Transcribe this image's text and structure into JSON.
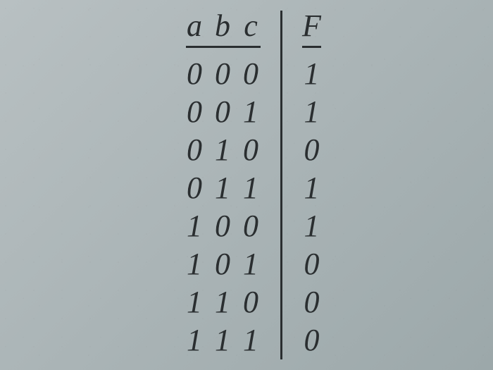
{
  "chart_data": {
    "type": "table",
    "title": "",
    "columns": [
      "a",
      "b",
      "c",
      "F"
    ],
    "rows": [
      {
        "a": "0",
        "b": "0",
        "c": "0",
        "F": "1"
      },
      {
        "a": "0",
        "b": "0",
        "c": "1",
        "F": "1"
      },
      {
        "a": "0",
        "b": "1",
        "c": "0",
        "F": "0"
      },
      {
        "a": "0",
        "b": "1",
        "c": "1",
        "F": "1"
      },
      {
        "a": "1",
        "b": "0",
        "c": "0",
        "F": "1"
      },
      {
        "a": "1",
        "b": "0",
        "c": "1",
        "F": "0"
      },
      {
        "a": "1",
        "b": "1",
        "c": "0",
        "F": "0"
      },
      {
        "a": "1",
        "b": "1",
        "c": "1",
        "F": "0"
      }
    ]
  }
}
